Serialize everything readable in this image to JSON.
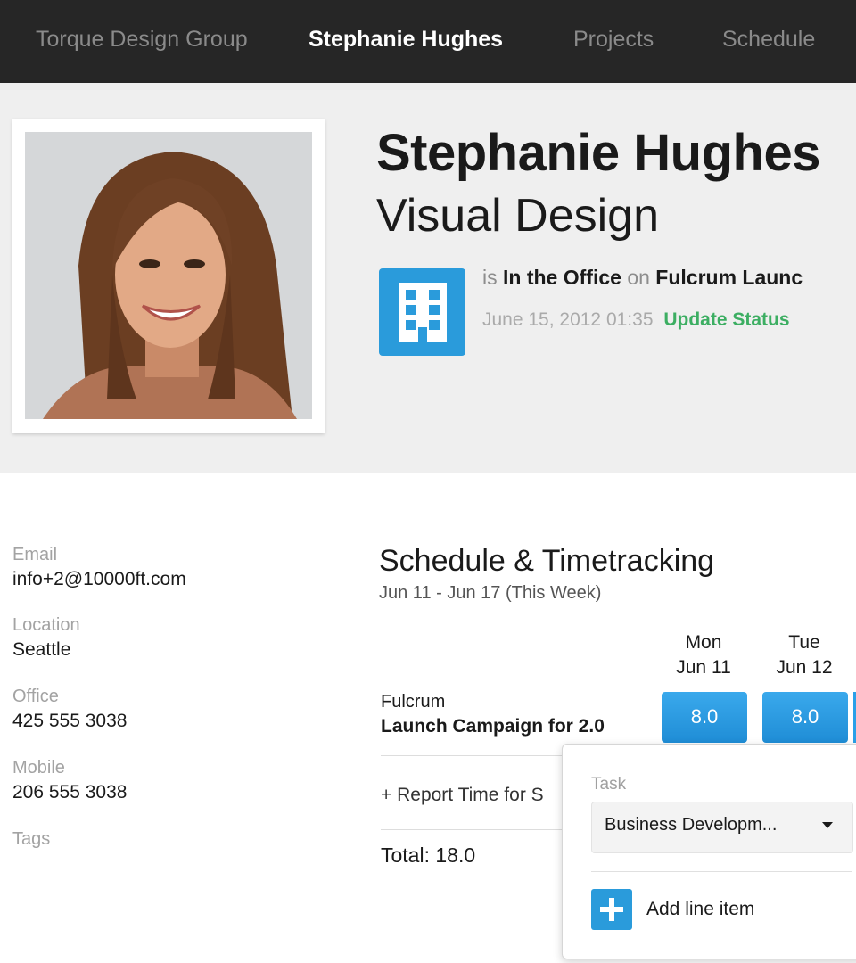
{
  "nav": {
    "items": [
      {
        "label": "Torque Design Group",
        "active": false
      },
      {
        "label": "Stephanie Hughes",
        "active": true
      },
      {
        "label": "Projects",
        "active": false
      },
      {
        "label": "Schedule",
        "active": false
      }
    ]
  },
  "profile": {
    "name": "Stephanie Hughes",
    "role": "Visual Design",
    "status": {
      "prefix": "is",
      "state": "In the Office",
      "connector": "on",
      "project": "Fulcrum Launc",
      "timestamp": "June 15, 2012 01:35",
      "update_label": "Update Status",
      "icon": "office-building-icon"
    }
  },
  "contact": {
    "email_label": "Email",
    "email": "info+2@10000ft.com",
    "location_label": "Location",
    "location": "Seattle",
    "office_label": "Office",
    "office": "425 555 3038",
    "mobile_label": "Mobile",
    "mobile": "206 555 3038",
    "tags_label": "Tags"
  },
  "schedule": {
    "title": "Schedule & Timetracking",
    "range": "Jun 11 - Jun 17 (This Week)",
    "days": [
      {
        "day": "Mon",
        "date": "Jun 11"
      },
      {
        "day": "Tue",
        "date": "Jun 12"
      }
    ],
    "row": {
      "client": "Fulcrum",
      "task": "Launch Campaign for 2.0",
      "hours": [
        "8.0",
        "8.0"
      ]
    },
    "report_label": "+ Report Time for S",
    "total": "Total: 18.0"
  },
  "popover": {
    "task_label": "Task",
    "task_value": "Business Developm...",
    "add_label": "Add line item"
  },
  "colors": {
    "nav_bg": "#262626",
    "accent_blue": "#2a9bdb",
    "status_green": "#3cae62"
  }
}
